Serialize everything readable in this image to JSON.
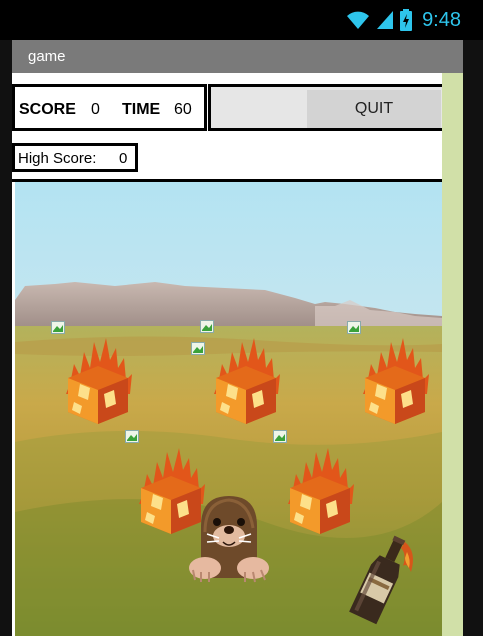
{
  "status_bar": {
    "time": "9:48",
    "accent_color": "#2ec5ec",
    "icons": [
      "wifi-icon",
      "signal-icon",
      "battery-icon"
    ]
  },
  "app": {
    "title": "game"
  },
  "score_panel": {
    "score_label": "SCORE",
    "score_value": "0",
    "time_label": "TIME",
    "time_value": "60"
  },
  "controls": {
    "quit_label": "QUIT"
  },
  "high_score": {
    "label": "High Score:",
    "value": "0"
  },
  "game_field": {
    "background": "prairie-with-mesa-landscape",
    "sprites": [
      "fire-block",
      "fire-block",
      "fire-block",
      "fire-block",
      "fire-block",
      "mole",
      "bottle",
      "broken-image-icon"
    ]
  }
}
